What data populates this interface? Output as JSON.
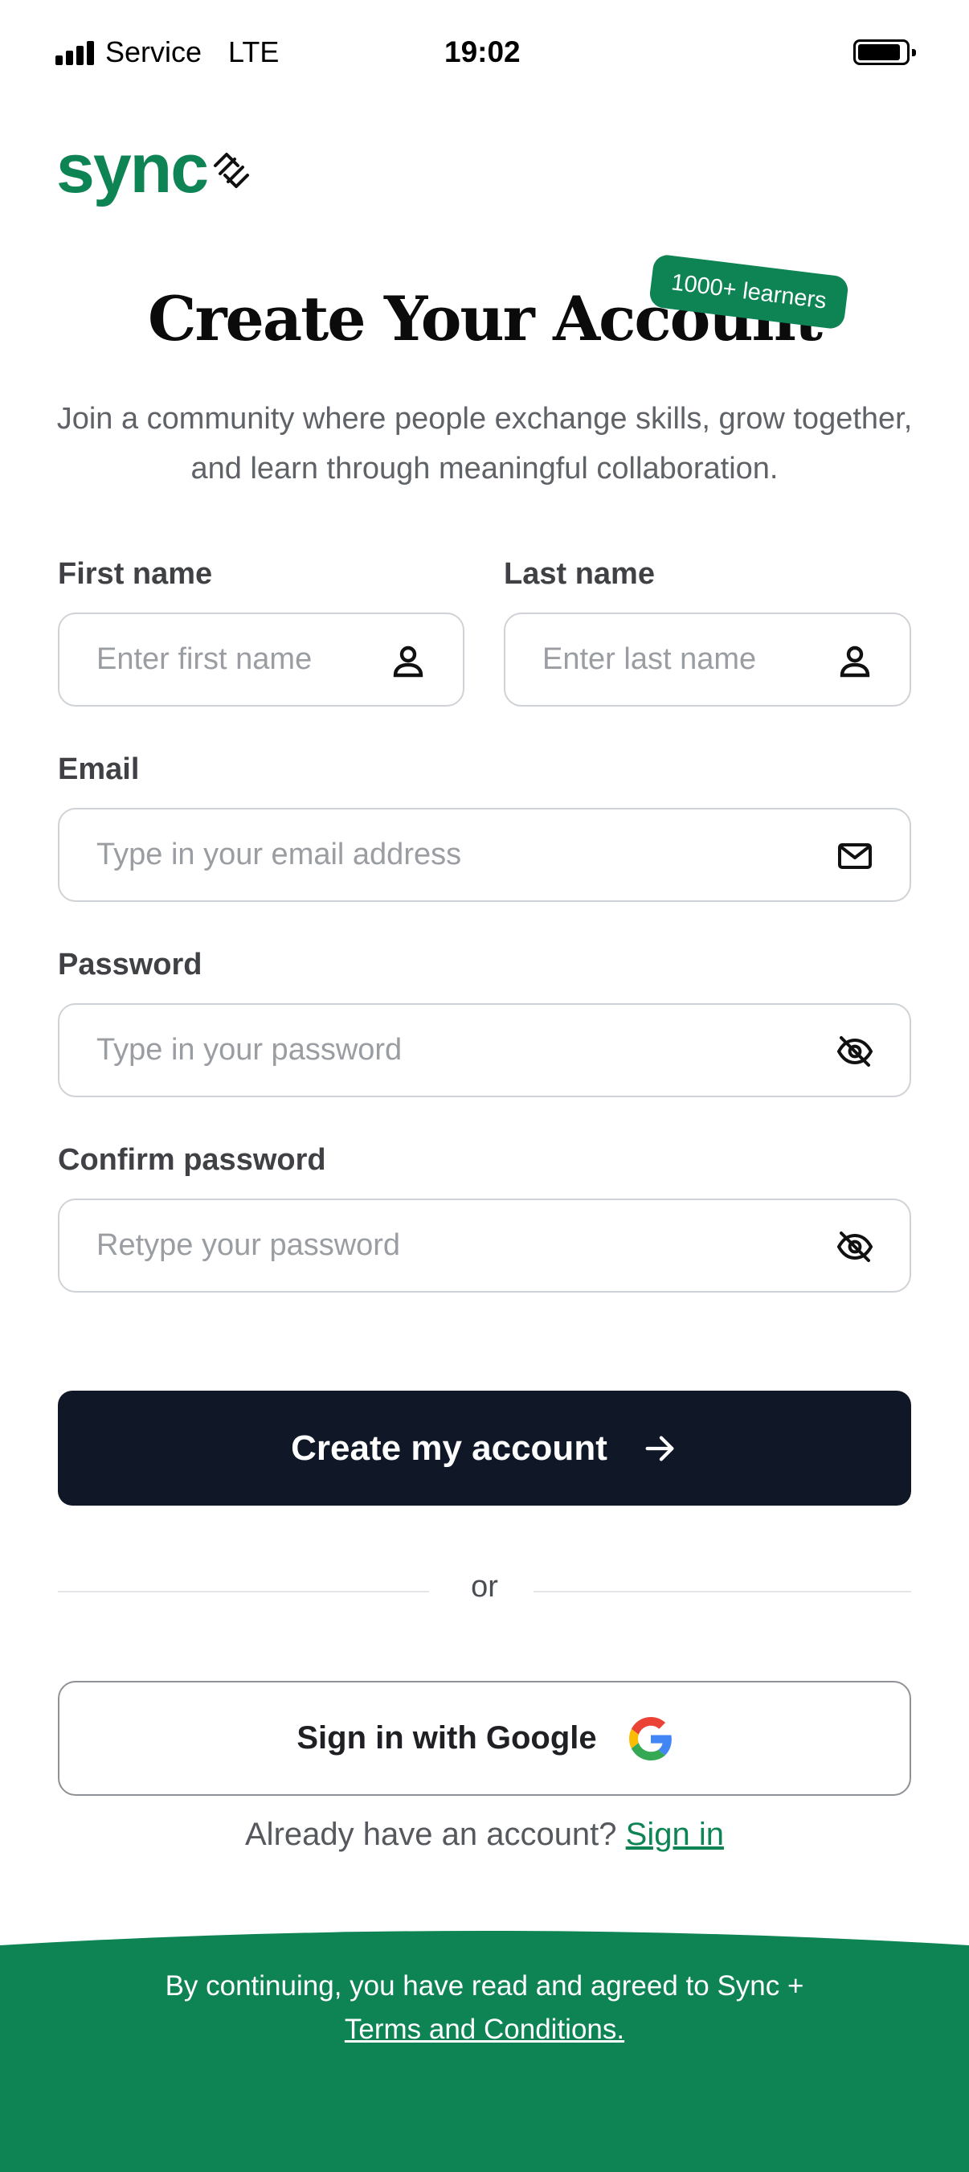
{
  "status_bar": {
    "carrier": "Service",
    "network": "LTE",
    "time": "19:02",
    "signal_bars": 4,
    "battery_level": 0.9
  },
  "brand": {
    "name": "sync",
    "logo_icon": "sync-arrows-icon",
    "primary_color": "#0e8455",
    "dark_color": "#101828"
  },
  "header": {
    "title": "Create Your Account",
    "badge": "1000+ learners",
    "subtitle": "Join a community where people exchange skills, grow together, and learn through meaningful collaboration."
  },
  "form": {
    "first_name": {
      "label": "First name",
      "placeholder": "Enter first name",
      "value": "",
      "icon": "user-icon"
    },
    "last_name": {
      "label": "Last name",
      "placeholder": "Enter last name",
      "value": "",
      "icon": "user-icon"
    },
    "email": {
      "label": "Email",
      "placeholder": "Type in your email address",
      "value": "",
      "icon": "mail-icon"
    },
    "password": {
      "label": "Password",
      "placeholder": "Type in your password",
      "value": "",
      "icon": "eye-off-icon"
    },
    "confirm_password": {
      "label": "Confirm password",
      "placeholder": "Retype your password",
      "value": "",
      "icon": "eye-off-icon"
    }
  },
  "actions": {
    "create_label": "Create my account",
    "create_icon": "arrow-right-icon",
    "divider": "or",
    "google_label": "Sign in with Google",
    "google_icon": "google-icon",
    "signin_prompt": "Already have an account?",
    "signin_link": "Sign in"
  },
  "footer": {
    "text": "By continuing, you have read and agreed to Sync +",
    "link": "Terms and Conditions."
  }
}
